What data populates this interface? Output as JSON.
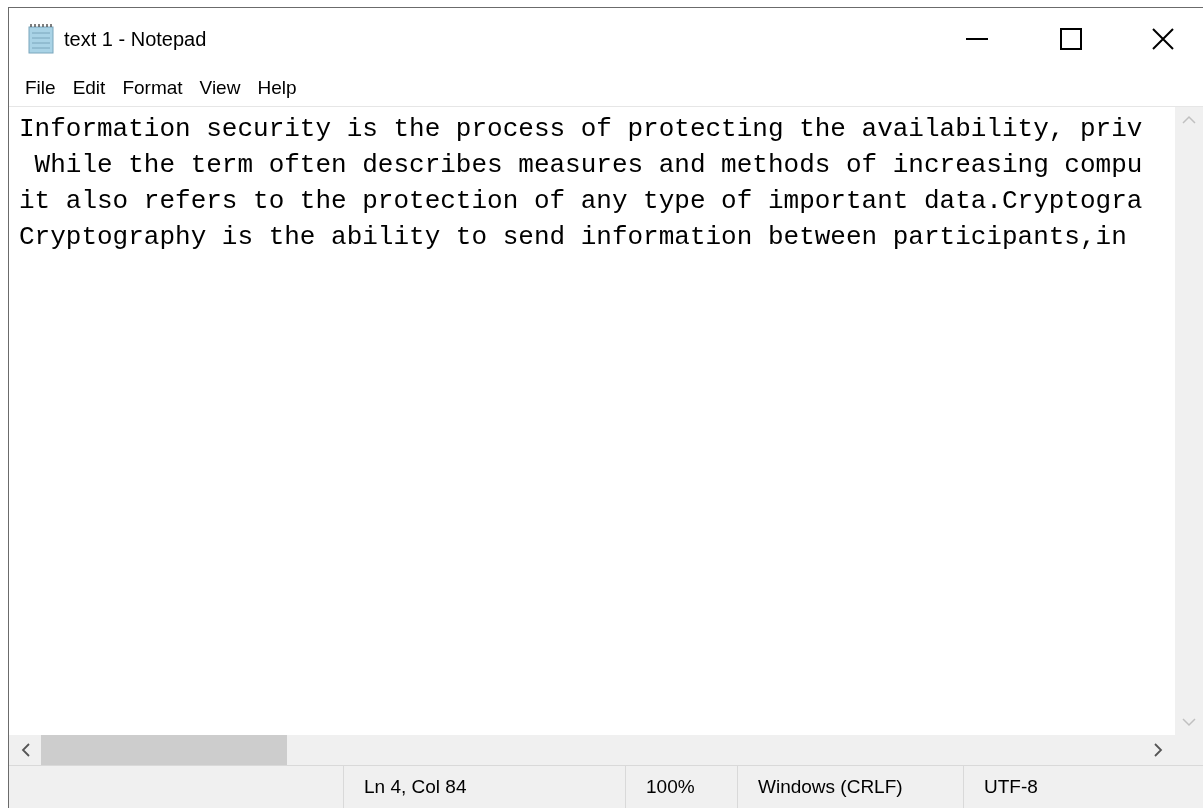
{
  "window": {
    "title": "text 1 - Notepad"
  },
  "menu": [
    "File",
    "Edit",
    "Format",
    "View",
    "Help"
  ],
  "document": {
    "lines": [
      "Information security is the process of protecting the availability, priv",
      " While the term often describes measures and methods of increasing compu",
      "it also refers to the protection of any type of important data.Cryptogra",
      "Cryptography is the ability to send information between participants,in"
    ]
  },
  "status_bar": [
    "Ln 4, Col 84",
    "100%",
    "Windows (CRLF)",
    "UTF-8"
  ]
}
